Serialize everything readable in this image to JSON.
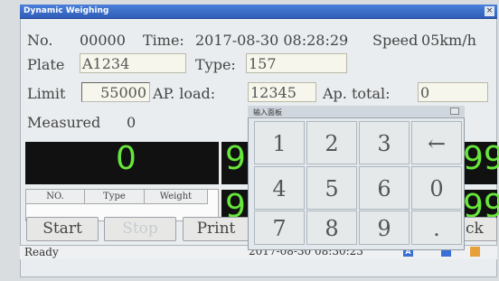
{
  "window": {
    "title": "Dynamic Weighing",
    "close_glyph": "×"
  },
  "info": {
    "no_label": "No.",
    "no_value": "00000",
    "time_label": "Time:",
    "time_value": "2017-08-30 08:28:29",
    "speed_label": "Speed",
    "speed_value": "05km/h"
  },
  "plate": {
    "label": "Plate",
    "value": "A1234"
  },
  "type": {
    "label": "Type:",
    "value": "157"
  },
  "limit": {
    "label": "Limit",
    "value": "55000"
  },
  "ap_load": {
    "label": "AP. load:",
    "value": "12345"
  },
  "ap_total": {
    "label": "Ap. total:",
    "value": "0"
  },
  "measured": {
    "label": "Measured",
    "value": "0"
  },
  "display": {
    "main_weight": "0",
    "mid_digit_1": "9",
    "mid_digit_2": "9",
    "right_value_1": "99",
    "right_value_2": "99"
  },
  "table": {
    "headers": [
      "NO.",
      "Type",
      "Weight"
    ]
  },
  "buttons": {
    "start": "Start",
    "stop": "Stop",
    "print": "Print",
    "back": "ck"
  },
  "status_bar": {
    "status": "Ready",
    "clock": "2017-08-30 08:30:23"
  },
  "keypad": {
    "title": "输入面板",
    "keys": [
      "1",
      "2",
      "3",
      "←",
      "4",
      "5",
      "6",
      "0",
      "7",
      "8",
      "9",
      "."
    ]
  },
  "colors": {
    "digit_green": "#67e63b",
    "display_bg": "#111111",
    "title_blue": "#2f5db8"
  }
}
